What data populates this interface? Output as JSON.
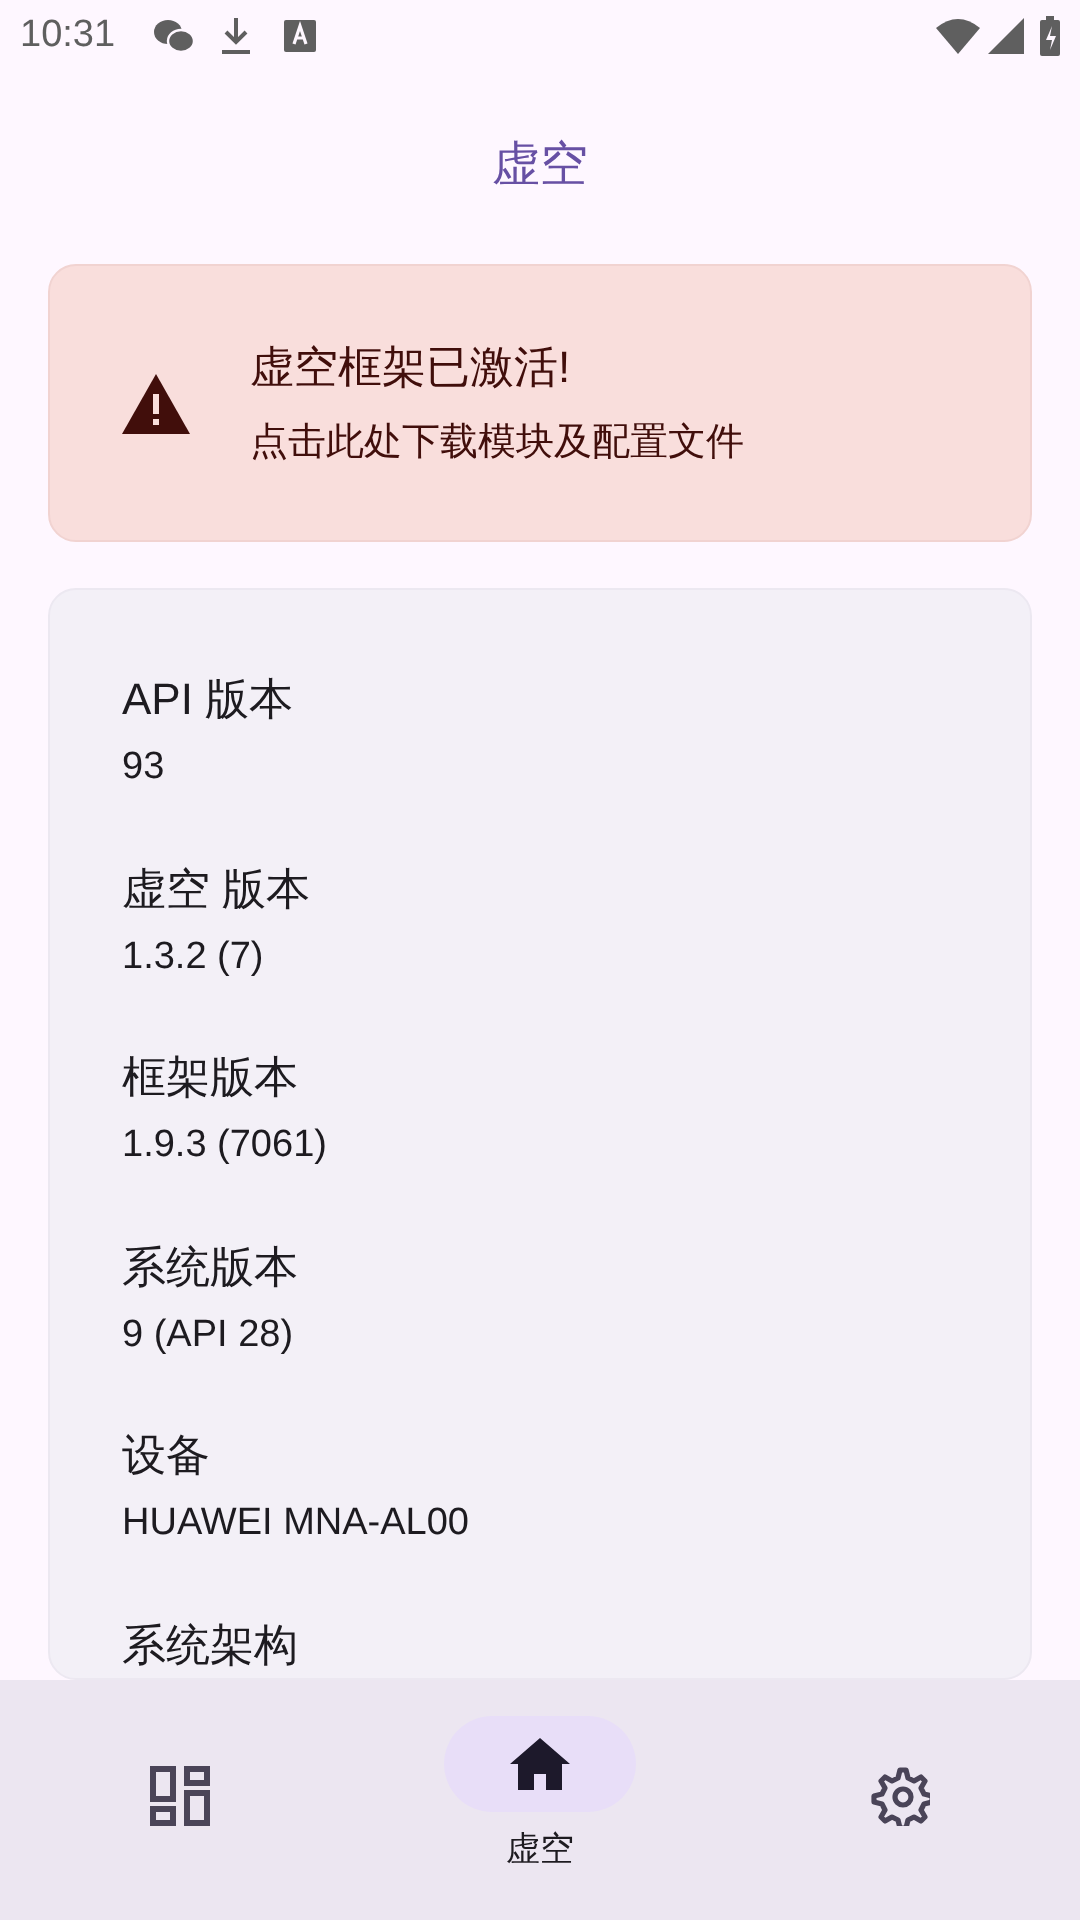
{
  "status_bar": {
    "time": "10:31"
  },
  "app_bar": {
    "title": "虚空"
  },
  "banner": {
    "title": "虚空框架已激活!",
    "subtitle": "点击此处下载模块及配置文件"
  },
  "info": [
    {
      "label": "API 版本",
      "value": "93"
    },
    {
      "label": "虚空 版本",
      "value": "1.3.2 (7)"
    },
    {
      "label": "框架版本",
      "value": "1.9.3 (7061)"
    },
    {
      "label": "系统版本",
      "value": "9 (API 28)"
    },
    {
      "label": "设备",
      "value": "HUAWEI MNA-AL00"
    },
    {
      "label": "系统架构"
    }
  ],
  "nav": [
    {
      "kind": "modules",
      "selected": false
    },
    {
      "kind": "home",
      "label": "虚空",
      "selected": true
    },
    {
      "kind": "settings",
      "selected": false
    }
  ]
}
